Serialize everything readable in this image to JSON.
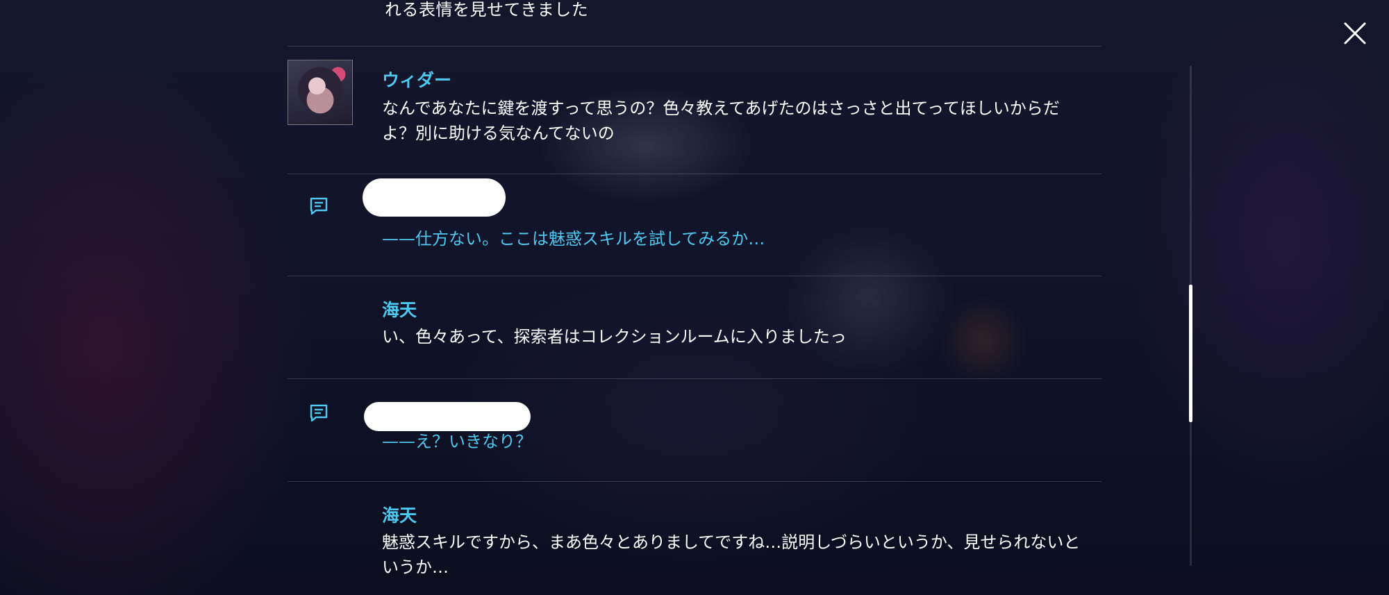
{
  "log": {
    "top_line": "れる表情を見せてきました",
    "entries": [
      {
        "type": "dialogue",
        "speaker": "ウィダー",
        "text": "なんであなたに鍵を渡すって思うの？色々教えてあげたのはさっさと出てってほしいからだよ？別に助ける気なんてないの"
      },
      {
        "type": "choice",
        "text": "——仕方ない。ここは魅惑スキルを試してみるか…"
      },
      {
        "type": "dialogue",
        "speaker": "海天",
        "text": "い、色々あって、探索者はコレクションルームに入りましたっ"
      },
      {
        "type": "choice",
        "text": "——え？いきなり？"
      },
      {
        "type": "dialogue",
        "speaker": "海天",
        "text": "魅惑スキルですから、まあ色々とありましてですね…説明しづらいというか、見せられないというか…"
      }
    ]
  },
  "icons": {
    "close": "close-icon",
    "choice": "chat-bubble-icon"
  },
  "colors": {
    "speaker": "#4fc8ee",
    "choice": "#4fc8ee",
    "text": "#ffffff"
  }
}
